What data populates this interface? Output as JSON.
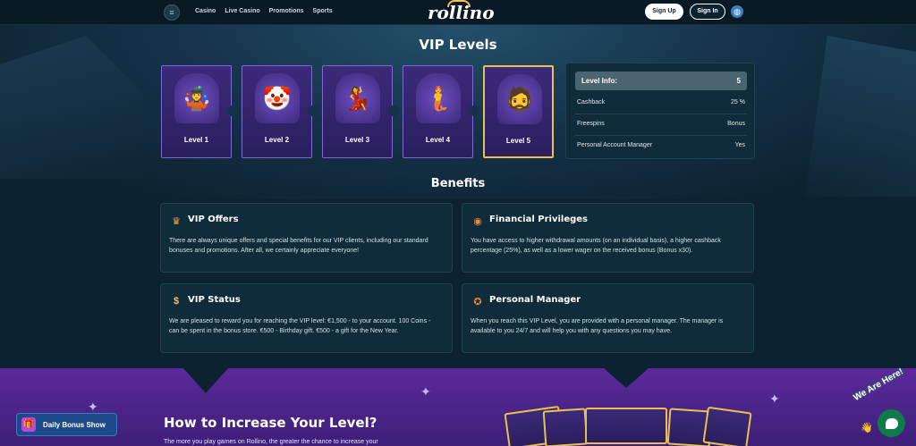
{
  "header": {
    "menu_icon": "hamburger-icon",
    "nav": [
      "Casino",
      "Live Casino",
      "Promotions",
      "Sports"
    ],
    "logo_text": "rollino",
    "signup_label": "Sign Up",
    "signin_label": "Sign In",
    "language_icon": "globe-icon"
  },
  "vip": {
    "title": "VIP Levels",
    "levels": [
      {
        "label": "Level 1",
        "icon": "🤹"
      },
      {
        "label": "Level 2",
        "icon": "🤡"
      },
      {
        "label": "Level 3",
        "icon": "💃"
      },
      {
        "label": "Level 4",
        "icon": "🧜"
      },
      {
        "label": "Level 5",
        "icon": "🧔"
      }
    ],
    "active_level": 5
  },
  "level_info": {
    "head_label": "Level Info:",
    "head_value": "5",
    "rows": [
      {
        "label": "Cashback",
        "value": "25 %"
      },
      {
        "label": "Freespins",
        "value": "Bonus"
      },
      {
        "label": "Personal Account Manager",
        "value": "Yes"
      }
    ]
  },
  "benefits": {
    "title": "Benefits",
    "items": [
      {
        "icon": "crown-icon",
        "glyph": "♛",
        "title": "VIP Offers",
        "text": "There are always unique offers and special benefits for our VIP clients, including our standard bonuses and promotions. After all, we certainly appreciate everyone!"
      },
      {
        "icon": "coins-icon",
        "glyph": "◉",
        "title": "Financial Privileges",
        "text": "You have access to higher withdrawal amounts (on an individual basis), a higher cashback percentage (25%), as well as a lower wager on the received bonus (Bonus x30)."
      },
      {
        "icon": "dollar-icon",
        "glyph": "$",
        "title": "VIP Status",
        "text": "We are pleased to reward you for reaching the VIP level: €1,500 - to your account. 100 Coins - can be spent in the bonus store. €500 - Birthday gift. €500 - a gift for the New Year."
      },
      {
        "icon": "medal-icon",
        "glyph": "✪",
        "title": "Personal Manager",
        "text": "When you reach this VIP Level, you are provided with a personal manager. The manager is available to you 24/7 and will help you with any questions you may have."
      }
    ]
  },
  "increase": {
    "title": "How to Increase Your Level?",
    "text": "The more you play games on Rollino, the greater the chance to increase your"
  },
  "daily_bonus": {
    "label": "Daily Bonus Show",
    "icon": "gift-icon"
  },
  "chat": {
    "label": "We Are Here!",
    "icon": "chat-icon"
  },
  "colors": {
    "background": "#0d2230",
    "card_purple": "#3c2a7a",
    "active_border": "#e8c14e",
    "panel": "#102b3a",
    "purple_section": "#5b2a9a"
  }
}
